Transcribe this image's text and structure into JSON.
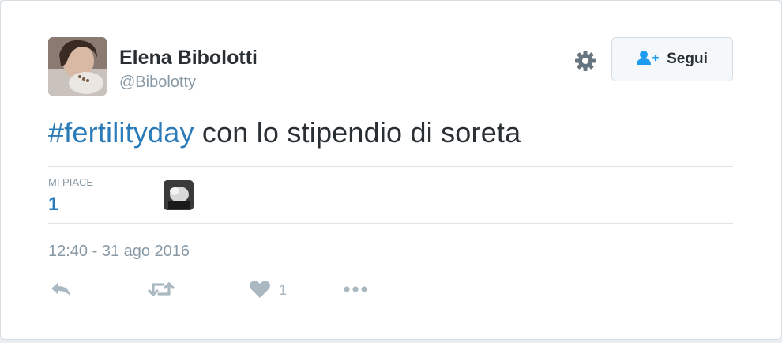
{
  "author": {
    "name": "Elena Bibolotti",
    "handle": "@Bibolotty"
  },
  "follow_button": {
    "label": "Segui"
  },
  "tweet": {
    "hashtag": "#fertilityday",
    "text": " con lo stipendio di soreta"
  },
  "stats": {
    "likes_label": "MI PIACE",
    "likes_value": "1"
  },
  "timestamp": "12:40 - 31 ago 2016",
  "actions": {
    "like_count": "1"
  },
  "icons": [
    "gear-icon",
    "follow-person-icon",
    "reply-icon",
    "retweet-icon",
    "heart-icon",
    "more-icon"
  ],
  "colors": {
    "accent": "#2b7bb9",
    "text": "#292f33",
    "muted": "#8899a6",
    "icon": "#aab8c2"
  }
}
